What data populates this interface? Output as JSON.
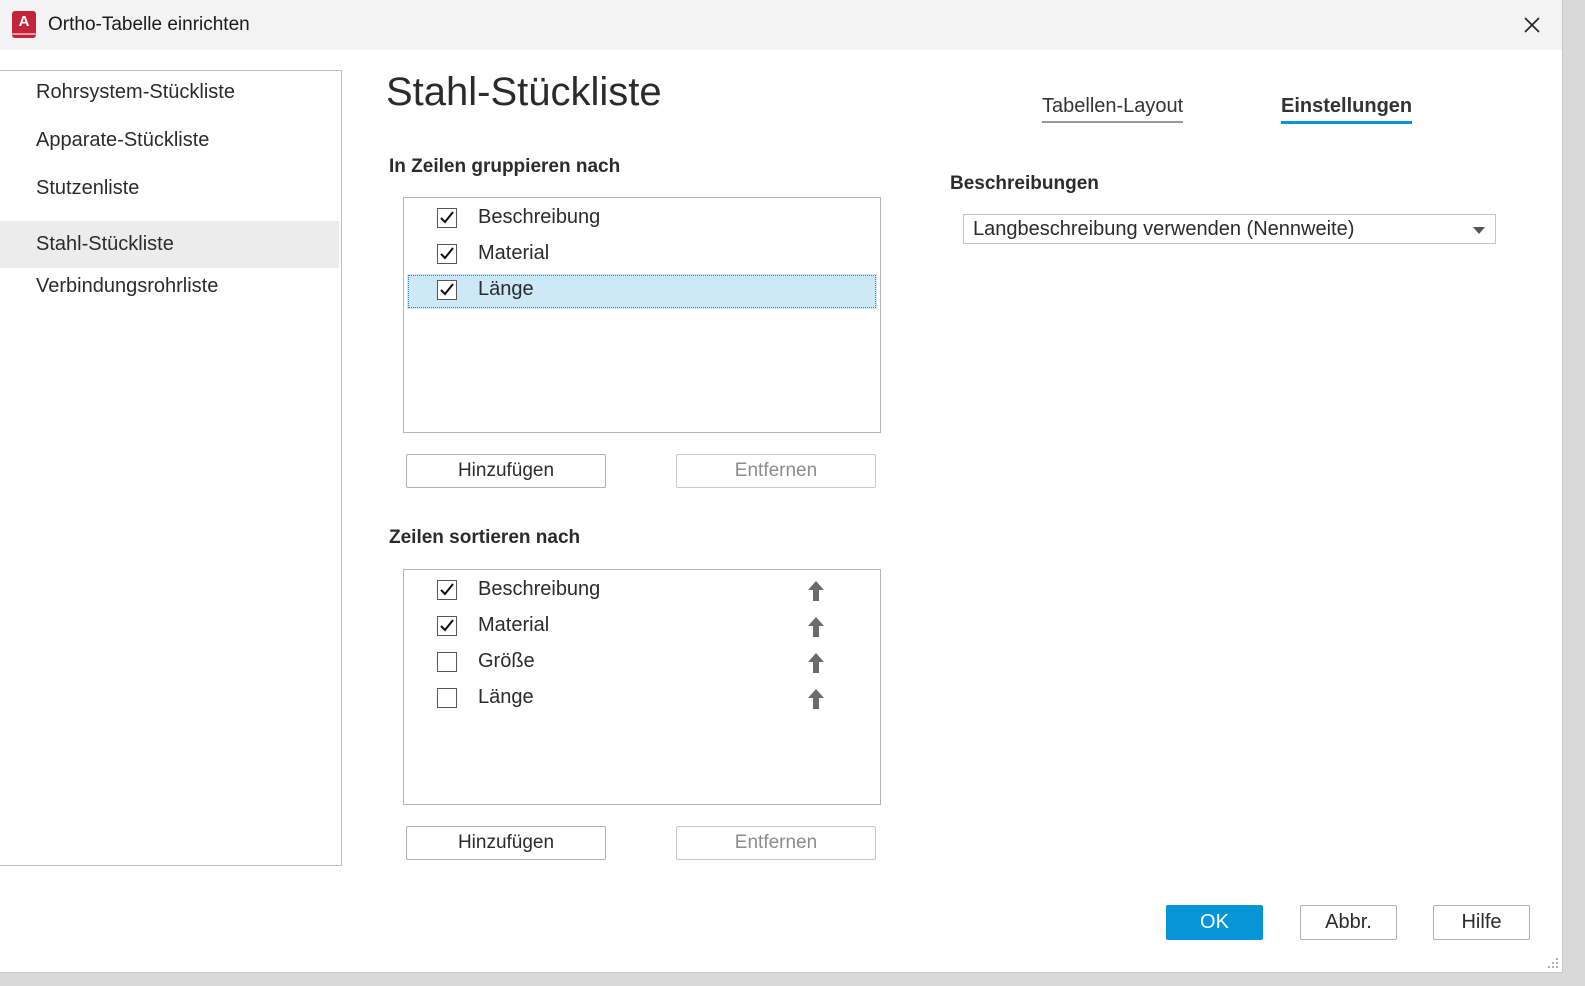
{
  "window": {
    "title": "Ortho-Tabelle einrichten",
    "app_icon": "autocad-icon",
    "app_icon_letter": "A"
  },
  "sidebar": {
    "items": [
      {
        "label": "Rohrsystem-Stückliste",
        "selected": false
      },
      {
        "label": "Apparate-Stückliste",
        "selected": false
      },
      {
        "label": "Stutzenliste",
        "selected": false
      },
      {
        "label": "Stahl-Stückliste",
        "selected": true
      },
      {
        "label": "Verbindungsrohrliste",
        "selected": false
      }
    ]
  },
  "main": {
    "title": "Stahl-Stückliste",
    "tabs": [
      {
        "label": "Tabellen-Layout",
        "active": false
      },
      {
        "label": "Einstellungen",
        "active": true
      }
    ],
    "group": {
      "label": "In Zeilen gruppieren nach",
      "items": [
        {
          "label": "Beschreibung",
          "checked": true
        },
        {
          "label": "Material",
          "checked": true
        },
        {
          "label": "Länge",
          "checked": true,
          "selected": true
        }
      ],
      "add_label": "Hinzufügen",
      "remove_label": "Entfernen"
    },
    "sort": {
      "label": "Zeilen sortieren nach",
      "items": [
        {
          "label": "Beschreibung",
          "checked": true,
          "direction": "ascending"
        },
        {
          "label": "Material",
          "checked": true,
          "direction": "ascending"
        },
        {
          "label": "Größe",
          "checked": false,
          "direction": "ascending"
        },
        {
          "label": "Länge",
          "checked": false,
          "direction": "ascending"
        }
      ],
      "add_label": "Hinzufügen",
      "remove_label": "Entfernen"
    },
    "descriptions": {
      "label": "Beschreibungen",
      "selected_value": "Langbeschreibung verwenden (Nennweite)"
    }
  },
  "footer": {
    "ok_label": "OK",
    "cancel_label": "Abbr.",
    "help_label": "Hilfe"
  },
  "colors": {
    "accent": "#0696d7",
    "selection": "#cde8f7",
    "app_icon": "#c2243b"
  }
}
